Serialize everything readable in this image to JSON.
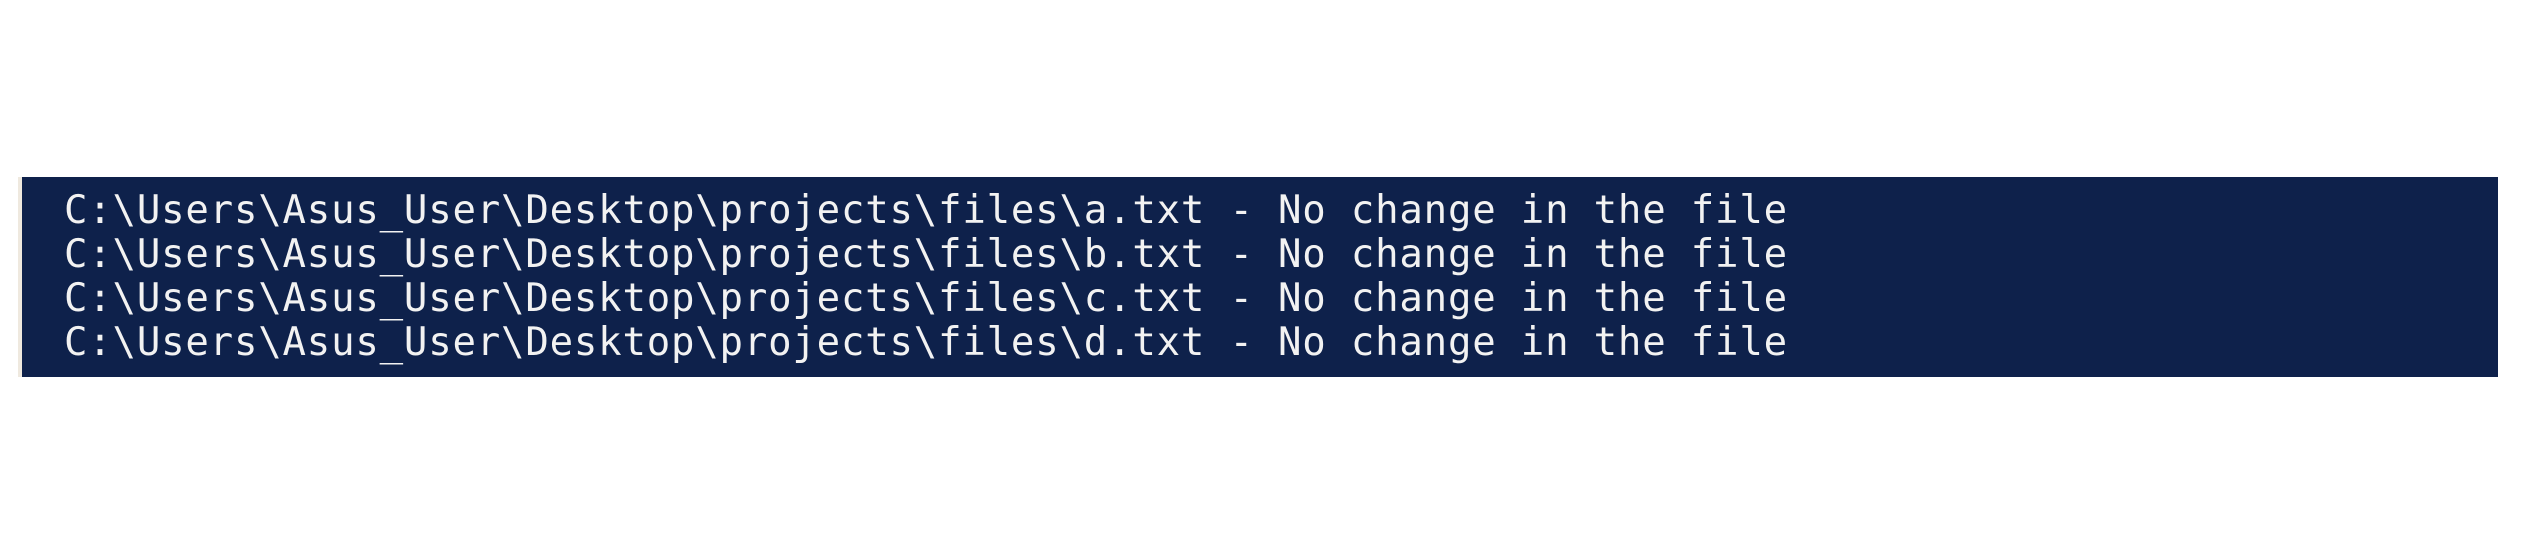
{
  "terminal": {
    "lines": [
      "C:\\Users\\Asus_User\\Desktop\\projects\\files\\a.txt - No change in the file",
      "C:\\Users\\Asus_User\\Desktop\\projects\\files\\b.txt - No change in the file",
      "C:\\Users\\Asus_User\\Desktop\\projects\\files\\c.txt - No change in the file",
      "C:\\Users\\Asus_User\\Desktop\\projects\\files\\d.txt - No change in the file"
    ]
  },
  "colors": {
    "terminal_background": "#0e214b",
    "terminal_text": "#f2f2f2",
    "page_background": "#ffffff"
  }
}
